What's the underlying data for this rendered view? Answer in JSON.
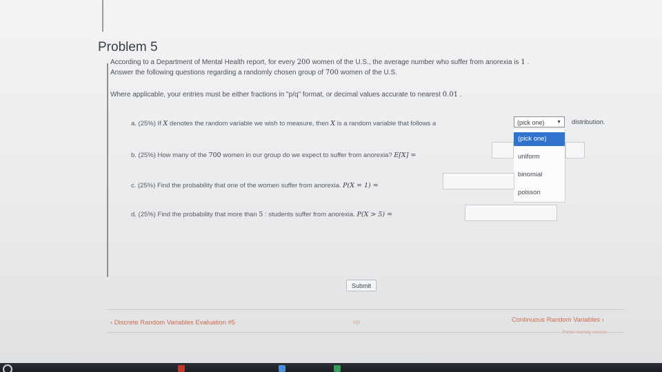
{
  "problem": {
    "title": "Problem 5",
    "intro_line1_a": "According to a Department of Mental Health report, for every",
    "intro_num_women": "200",
    "intro_line1_b": "women of the U.S., the average number who suffer from anorexia is",
    "intro_avg": "1",
    "intro_line1_end": ".",
    "intro_line2_a": "Answer the following questions regarding a randomly chosen group of",
    "intro_group": "700",
    "intro_line2_b": "women of the U.S.",
    "format_a": "Where applicable, your entries must be either fractions in \"p/q\" format, or decimal values accurate to nearest",
    "format_precision": "0.01",
    "format_end": "."
  },
  "questions": {
    "a": {
      "text_a": "a. (25%)  If",
      "var": "X",
      "text_b": "denotes the random variable we wish to measure, then",
      "var2": "X",
      "text_c": "is a random variable that follows a",
      "select_value": "(pick one)",
      "after": "distribution.",
      "options": [
        "(pick one)",
        "uniform",
        "binomial",
        "poisson"
      ]
    },
    "b": {
      "text_a": "b. (25%)  How many of the",
      "num": "700",
      "text_b": "women in our group do we expect to suffer from anorexia?",
      "expr": "E[X] =",
      "value": ""
    },
    "c": {
      "text_a": "c. (25%)  Find the probability that one of the women suffer from anorexia.",
      "expr": "P(X = 1) =",
      "value": ""
    },
    "d": {
      "text_a": "d. (25%)  Find the probability that more than",
      "num": "5",
      "text_b": ": students suffer from anorexia.",
      "expr": "P(X > 5) =",
      "value": ""
    }
  },
  "submit_label": "Submit",
  "nav": {
    "prev": "‹ Discrete Random Variables Evaluation #5",
    "up": "up",
    "next": "Continuous Random Variables ›",
    "printer": "Printer-friendly version"
  },
  "colors": {
    "accent": "#2f73cc",
    "link": "#d06a4e"
  }
}
